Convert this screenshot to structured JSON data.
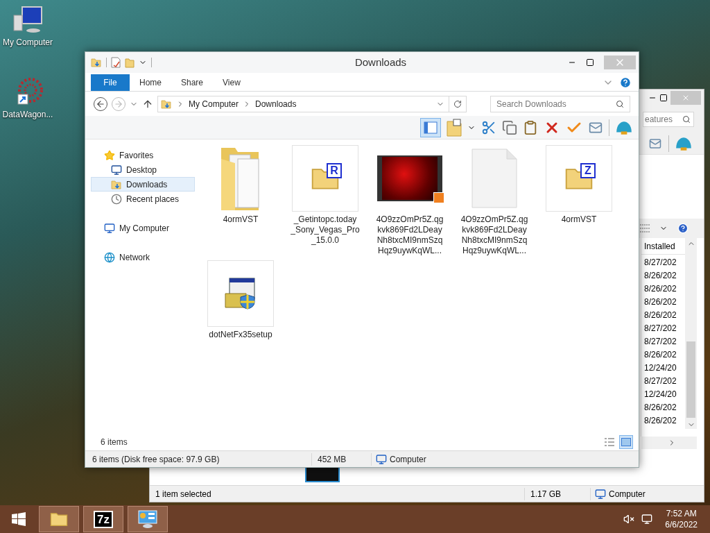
{
  "desktop_icons": [
    {
      "kind": "computer",
      "label": "My Computer"
    },
    {
      "kind": "shortcut",
      "label": "DataWagon..."
    }
  ],
  "back_window": {
    "search": {
      "placeholder": "eatures"
    },
    "column_header": "Installed",
    "dates": [
      "8/27/202",
      "8/26/202",
      "8/26/202",
      "8/26/202",
      "8/26/202",
      "8/27/202",
      "8/27/202",
      "8/26/202",
      "12/24/20",
      "8/27/202",
      "12/24/20",
      "8/26/202",
      "8/26/202"
    ],
    "status": {
      "selection": "1 item selected",
      "size": "1.17 GB",
      "location": "Computer"
    }
  },
  "window": {
    "title": "Downloads",
    "ribbon_tabs": [
      {
        "label": "File",
        "kind": "menu"
      },
      {
        "label": "Home",
        "kind": "tab"
      },
      {
        "label": "Share",
        "kind": "tab"
      },
      {
        "label": "View",
        "kind": "tab"
      }
    ],
    "address": {
      "crumbs": [
        "My Computer",
        "Downloads"
      ]
    },
    "search": {
      "placeholder": "Search Downloads"
    },
    "nav": [
      {
        "label": "Favorites",
        "kind": "favorites",
        "selected": false,
        "children": [
          {
            "label": "Desktop",
            "kind": "desktop",
            "selected": false
          },
          {
            "label": "Downloads",
            "kind": "downloads",
            "selected": true
          },
          {
            "label": "Recent places",
            "kind": "recent",
            "selected": false
          }
        ]
      },
      {
        "label": "My Computer",
        "kind": "computer",
        "selected": false
      },
      {
        "label": "Network",
        "kind": "network",
        "selected": false
      }
    ],
    "files": [
      {
        "kind": "folder",
        "name_lines": [
          "4ormVST"
        ]
      },
      {
        "kind": "archive",
        "badge": "R",
        "name_lines": [
          "_Getintopc.today",
          "_Sony_Vegas_Pro",
          "_15.0.0"
        ]
      },
      {
        "kind": "video",
        "name_lines": [
          "4O9zzOmPr5Z.qg",
          "kvk869Fd2LDeay",
          "Nh8txcMI9nmSzq",
          "Hqz9uywKqWL..."
        ]
      },
      {
        "kind": "document",
        "name_lines": [
          "4O9zzOmPr5Z.qg",
          "kvk869Fd2LDeay",
          "Nh8txcMI9nmSzq",
          "Hqz9uywKqWL..."
        ]
      },
      {
        "kind": "archive",
        "badge": "Z",
        "name_lines": [
          "4ormVST"
        ]
      },
      {
        "kind": "installer",
        "name_lines": [
          "dotNetFx35setup"
        ]
      }
    ],
    "item_count": "6 items",
    "view_buttons": [
      {
        "kind": "details",
        "selected": false
      },
      {
        "kind": "thumbnails",
        "selected": true
      }
    ],
    "status": {
      "summary": "6 items (Disk free space: 97.9 GB)",
      "size": "452 MB",
      "location": "Computer"
    }
  },
  "taskbar": {
    "apps": [
      {
        "kind": "explorer",
        "active": true
      },
      {
        "kind": "archiver",
        "text": "7z",
        "active": true
      },
      {
        "kind": "control-panel",
        "active": true
      }
    ],
    "time": "7:52 AM",
    "date": "6/6/2022"
  }
}
